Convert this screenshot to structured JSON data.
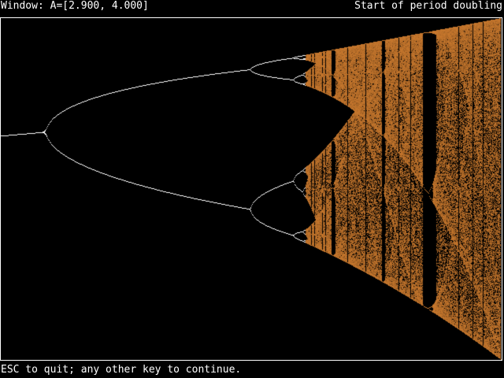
{
  "header": {
    "window_label": "Window: A=[2.900, 4.000]",
    "status_title": "Start of period doubling"
  },
  "plot": {
    "a_min": 2.9,
    "a_max": 4.0,
    "background": "#000000",
    "stable_color": "#ffffff",
    "chaos_color": "#c8782d"
  },
  "footer": {
    "prompt": "ESC to quit; any other key to continue."
  }
}
